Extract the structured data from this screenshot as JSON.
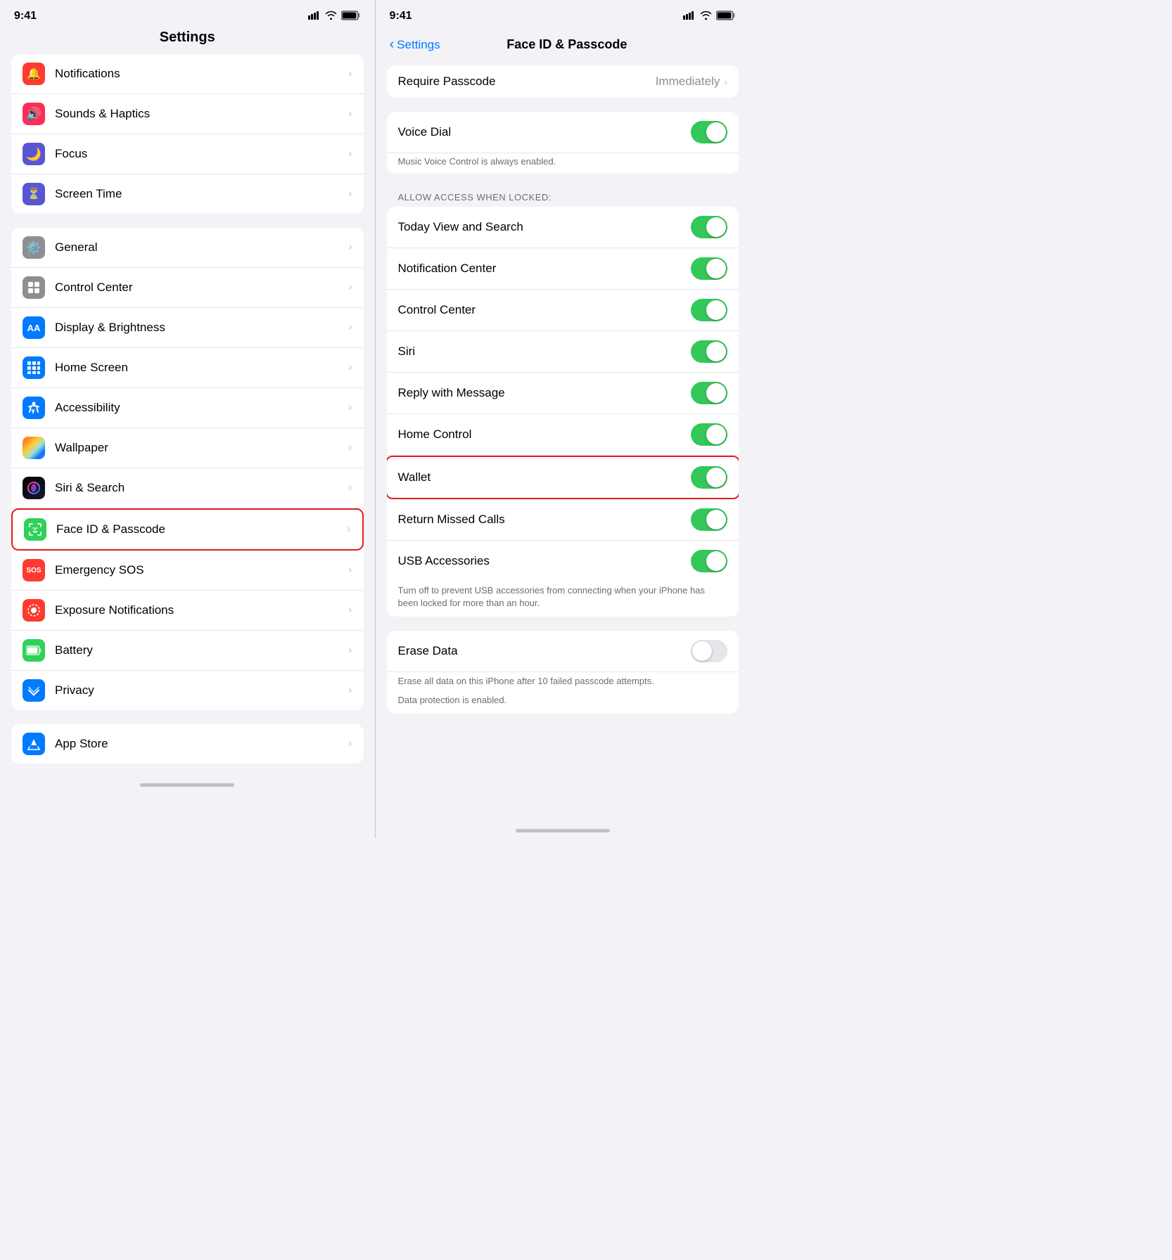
{
  "left": {
    "statusBar": {
      "time": "9:41",
      "signal": "▲▲▲",
      "wifi": "wifi",
      "battery": "battery"
    },
    "title": "Settings",
    "group1": [
      {
        "id": "notifications",
        "label": "Notifications",
        "iconBg": "icon-notifications",
        "iconChar": "🔔"
      },
      {
        "id": "sounds",
        "label": "Sounds & Haptics",
        "iconBg": "icon-sounds",
        "iconChar": "🔊"
      },
      {
        "id": "focus",
        "label": "Focus",
        "iconBg": "icon-focus",
        "iconChar": "🌙"
      },
      {
        "id": "screentime",
        "label": "Screen Time",
        "iconBg": "icon-screentime",
        "iconChar": "⏳"
      }
    ],
    "group2": [
      {
        "id": "general",
        "label": "General",
        "iconBg": "icon-general",
        "iconChar": "⚙️",
        "highlighted": false
      },
      {
        "id": "controlcenter",
        "label": "Control Center",
        "iconBg": "icon-control",
        "iconChar": "⊞",
        "highlighted": false
      },
      {
        "id": "display",
        "label": "Display & Brightness",
        "iconBg": "icon-display",
        "iconChar": "AA",
        "highlighted": false
      },
      {
        "id": "homescreen",
        "label": "Home Screen",
        "iconBg": "icon-homescreen",
        "iconChar": "⊞",
        "highlighted": false
      },
      {
        "id": "accessibility",
        "label": "Accessibility",
        "iconBg": "icon-accessibility",
        "iconChar": "♿",
        "highlighted": false
      },
      {
        "id": "wallpaper",
        "label": "Wallpaper",
        "iconBg": "icon-wallpaper",
        "iconChar": "❋",
        "highlighted": false
      },
      {
        "id": "siri",
        "label": "Siri & Search",
        "iconBg": "icon-siri",
        "iconChar": "◎",
        "highlighted": false
      },
      {
        "id": "faceid",
        "label": "Face ID & Passcode",
        "iconBg": "icon-faceid",
        "iconChar": "😀",
        "highlighted": true
      },
      {
        "id": "sos",
        "label": "Emergency SOS",
        "iconBg": "icon-sos",
        "iconChar": "SOS",
        "highlighted": false
      },
      {
        "id": "exposure",
        "label": "Exposure Notifications",
        "iconBg": "icon-exposure",
        "iconChar": "◉",
        "highlighted": false
      },
      {
        "id": "battery",
        "label": "Battery",
        "iconBg": "icon-battery",
        "iconChar": "🔋",
        "highlighted": false
      },
      {
        "id": "privacy",
        "label": "Privacy",
        "iconBg": "icon-privacy",
        "iconChar": "✋",
        "highlighted": false
      }
    ],
    "group3": [
      {
        "id": "appstore",
        "label": "App Store",
        "iconBg": "icon-appstore",
        "iconChar": "A",
        "highlighted": false
      }
    ]
  },
  "right": {
    "statusBar": {
      "time": "9:41"
    },
    "backLabel": "Settings",
    "title": "Face ID & Passcode",
    "requirePasscode": {
      "label": "Require Passcode",
      "value": "Immediately"
    },
    "voiceDial": {
      "label": "Voice Dial",
      "note": "Music Voice Control is always enabled.",
      "toggled": true
    },
    "allowAccessHeader": "ALLOW ACCESS WHEN LOCKED:",
    "accessItems": [
      {
        "id": "todayview",
        "label": "Today View and Search",
        "on": true,
        "walletHighlight": false
      },
      {
        "id": "notificationcenter",
        "label": "Notification Center",
        "on": true,
        "walletHighlight": false
      },
      {
        "id": "controlcenter",
        "label": "Control Center",
        "on": true,
        "walletHighlight": false
      },
      {
        "id": "siri",
        "label": "Siri",
        "on": true,
        "walletHighlight": false
      },
      {
        "id": "replywithmessage",
        "label": "Reply with Message",
        "on": true,
        "walletHighlight": false
      },
      {
        "id": "homecontrol",
        "label": "Home Control",
        "on": true,
        "walletHighlight": false
      },
      {
        "id": "wallet",
        "label": "Wallet",
        "on": true,
        "walletHighlight": true
      },
      {
        "id": "returnmissedcalls",
        "label": "Return Missed Calls",
        "on": true,
        "walletHighlight": false
      },
      {
        "id": "usbaccessories",
        "label": "USB Accessories",
        "on": true,
        "walletHighlight": false
      }
    ],
    "usbNote": "Turn off to prevent USB accessories from connecting when your iPhone has been locked for more than an hour.",
    "eraseData": {
      "label": "Erase Data",
      "on": false,
      "note1": "Erase all data on this iPhone after 10 failed passcode attempts.",
      "note2": "Data protection is enabled."
    }
  }
}
